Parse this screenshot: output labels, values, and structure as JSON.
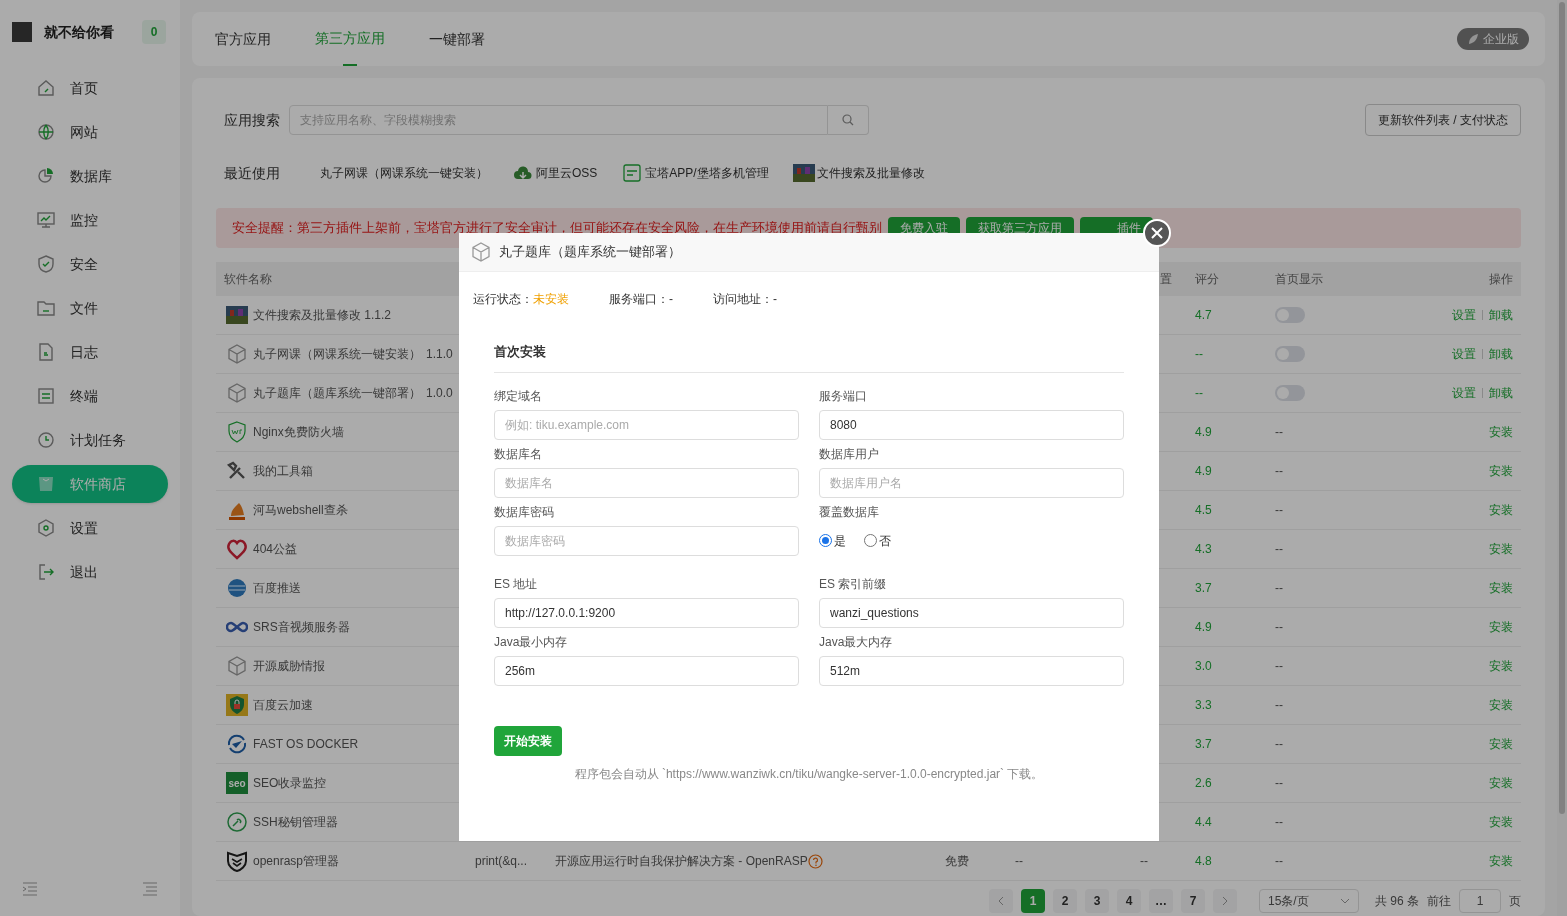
{
  "sidebar": {
    "user": {
      "name": "就不给你看",
      "badge": "0"
    },
    "items": [
      {
        "label": "首页",
        "kind": "home",
        "selected": false
      },
      {
        "label": "网站",
        "kind": "globe",
        "selected": false
      },
      {
        "label": "数据库",
        "kind": "pie",
        "selected": false
      },
      {
        "label": "监控",
        "kind": "monitor",
        "selected": false
      },
      {
        "label": "安全",
        "kind": "shield",
        "selected": false
      },
      {
        "label": "文件",
        "kind": "folder",
        "selected": false
      },
      {
        "label": "日志",
        "kind": "doc",
        "selected": false
      },
      {
        "label": "终端",
        "kind": "terminal",
        "selected": false
      },
      {
        "label": "计划任务",
        "kind": "clock",
        "selected": false
      },
      {
        "label": "软件商店",
        "kind": "store",
        "selected": true
      },
      {
        "label": "设置",
        "kind": "gear",
        "selected": false
      },
      {
        "label": "退出",
        "kind": "logout",
        "selected": false
      }
    ]
  },
  "top_tabs": [
    {
      "label": "官方应用",
      "selected": false
    },
    {
      "label": "第三方应用",
      "selected": true
    },
    {
      "label": "一键部署",
      "selected": false
    }
  ],
  "edition_badge": "企业版",
  "search": {
    "label": "应用搜索",
    "placeholder": "支持应用名称、字段模糊搜索"
  },
  "update_button": "更新软件列表 / 支付状态",
  "recent": {
    "label": "最近使用",
    "items": [
      {
        "label": "丸子网课（网课系统一键安装）",
        "kind": "none"
      },
      {
        "label": "阿里云OSS",
        "kind": "cloud"
      },
      {
        "label": "宝塔APP/堡塔多机管理",
        "kind": "app"
      },
      {
        "label": "文件搜索及批量修改",
        "kind": "photo"
      }
    ]
  },
  "alert": {
    "text": "安全提醒：第三方插件上架前，宝塔官方进行了安全审计，但可能还存在安全风险，在生产环境使用前请自行甄别",
    "buttons": [
      "免费入驻",
      "获取第三方应用",
      "插件"
    ]
  },
  "table": {
    "columns": {
      "name": "软件名称",
      "column_6": "置",
      "rating": "评分",
      "homepage": "首页显示",
      "actions": "操作"
    },
    "rows": [
      {
        "kind": "photo",
        "name": "文件搜索及批量修改 1.1.2",
        "rating": "4.7",
        "homepage": {
          "kind": "toggle",
          "on": false
        },
        "actions": [
          "设置",
          "卸载"
        ]
      },
      {
        "kind": "cube",
        "name": "丸子网课（网课系统一键安装）",
        "version": "1.1.0",
        "rating": "--",
        "homepage": {
          "kind": "toggle",
          "on": false
        },
        "actions": [
          "设置",
          "卸载"
        ]
      },
      {
        "kind": "cube",
        "name": "丸子题库（题库系统一键部署）",
        "version": "1.0.0",
        "rating": "--",
        "homepage": {
          "kind": "toggle",
          "on": false
        },
        "actions": [
          "设置",
          "卸载"
        ]
      },
      {
        "kind": "waf",
        "name": "Nginx免费防火墙",
        "rating": "4.9",
        "homepage": {
          "kind": "text",
          "text": "--"
        },
        "actions": [
          "安装"
        ]
      },
      {
        "kind": "tools",
        "name": "我的工具箱",
        "rating": "4.9",
        "homepage": {
          "kind": "text",
          "text": "--"
        },
        "actions": [
          "安装"
        ]
      },
      {
        "kind": "hippo",
        "name": "河马webshell查杀",
        "rating": "4.5",
        "homepage": {
          "kind": "text",
          "text": "--"
        },
        "actions": [
          "安装"
        ]
      },
      {
        "kind": "heart",
        "name": "404公益",
        "rating": "4.3",
        "homepage": {
          "kind": "text",
          "text": "--"
        },
        "actions": [
          "安装"
        ]
      },
      {
        "kind": "globe-blue",
        "name": "百度推送",
        "rating": "3.7",
        "homepage": {
          "kind": "text",
          "text": "--"
        },
        "actions": [
          "安装"
        ]
      },
      {
        "kind": "infinity",
        "name": "SRS音视频服务器",
        "rating": "4.9",
        "homepage": {
          "kind": "text",
          "text": "--"
        },
        "actions": [
          "安装"
        ]
      },
      {
        "kind": "cube",
        "name": "开源威胁情报",
        "rating": "3.0",
        "homepage": {
          "kind": "text",
          "text": "--"
        },
        "actions": [
          "安装"
        ]
      },
      {
        "kind": "lock-shield",
        "name": "百度云加速",
        "rating": "3.3",
        "homepage": {
          "kind": "text",
          "text": "--"
        },
        "actions": [
          "安装"
        ]
      },
      {
        "kind": "swirl",
        "name": "FAST OS DOCKER",
        "rating": "3.7",
        "homepage": {
          "kind": "text",
          "text": "--"
        },
        "actions": [
          "安装"
        ]
      },
      {
        "kind": "seo",
        "icon_text": "seo",
        "name": "SEO收录监控",
        "rating": "2.6",
        "homepage": {
          "kind": "text",
          "text": "--"
        },
        "actions": [
          "安装"
        ]
      },
      {
        "kind": "key",
        "name": "SSH秘钥管理器",
        "rating": "4.4",
        "homepage": {
          "kind": "text",
          "text": "--"
        },
        "actions": [
          "安装"
        ]
      },
      {
        "kind": "rasp",
        "name": "openrasp管理器",
        "column_2": "print(&q...",
        "column_3": "开源应用运行时自我保护解决方案 - OpenRASP",
        "column_4": "免费",
        "column_5": "--",
        "column_6": "--",
        "rating": "4.8",
        "homepage": {
          "kind": "text",
          "text": "--"
        },
        "actions": [
          "安装"
        ]
      }
    ]
  },
  "pagination": {
    "pages": [
      {
        "label": "1",
        "selected": true
      },
      {
        "label": "2",
        "selected": false
      },
      {
        "label": "3",
        "selected": false
      },
      {
        "label": "4",
        "selected": false
      },
      {
        "label": "…",
        "selected": false
      },
      {
        "label": "7",
        "selected": false
      }
    ],
    "page_size": "15条/页",
    "total": "共 96 条",
    "goto_label": "前往",
    "goto_value": "1",
    "page_suffix": "页"
  },
  "modal": {
    "title": "丸子题库（题库系统一键部署）",
    "status": [
      {
        "label": "运行状态：",
        "value": "未安装",
        "kind": "warning"
      },
      {
        "label": "服务端口：",
        "value": "-",
        "kind": "plain"
      },
      {
        "label": "访问地址：",
        "value": "-",
        "kind": "plain"
      }
    ],
    "section_title": "首次安装",
    "fields": [
      {
        "kind": "input",
        "label": "绑定域名",
        "placeholder": "例如: tiku.example.com"
      },
      {
        "kind": "input",
        "label": "服务端口",
        "value": "8080"
      },
      {
        "kind": "input",
        "label": "数据库名",
        "placeholder": "数据库名"
      },
      {
        "kind": "input",
        "label": "数据库用户",
        "placeholder": "数据库用户名"
      },
      {
        "kind": "input",
        "label": "数据库密码",
        "placeholder": "数据库密码"
      },
      {
        "kind": "radio",
        "label": "覆盖数据库",
        "options": [
          {
            "label": "是",
            "selected": true
          },
          {
            "label": "否",
            "selected": false
          }
        ]
      },
      {
        "kind": "input",
        "label": "ES 地址",
        "value": "http://127.0.0.1:9200"
      },
      {
        "kind": "input",
        "label": "ES 索引前缀",
        "value": "wanzi_questions"
      },
      {
        "kind": "input",
        "label": "Java最小内存",
        "value": "256m"
      },
      {
        "kind": "input",
        "label": "Java最大内存",
        "value": "512m"
      }
    ],
    "submit": "开始安装",
    "note": "程序包会自动从 `https://www.wanziwk.cn/tiku/wangke-server-1.0.0-encrypted.jar` 下载。"
  }
}
